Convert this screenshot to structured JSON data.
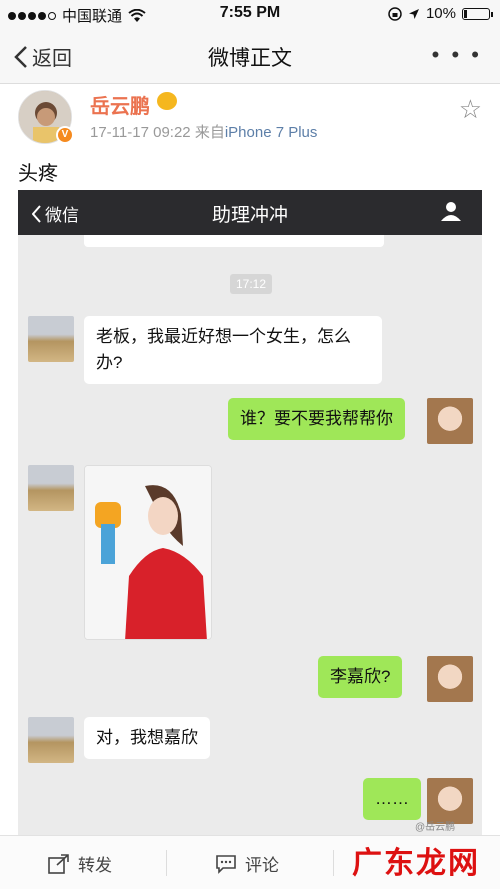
{
  "status": {
    "carrier": "中国联通",
    "time": "7:55 PM",
    "battery": "10%",
    "battery_level": 0.1
  },
  "nav": {
    "back_label": "返回",
    "title": "微博正文",
    "more_label": "• • •"
  },
  "post": {
    "author": "岳云鹏",
    "date": "17-11-17 09:22",
    "source_prefix": "来自",
    "source": "iPhone 7 Plus",
    "text": "头疼"
  },
  "chat": {
    "back_label": "微信",
    "title": "助理冲冲",
    "time_badge": "17:12",
    "messages": [
      {
        "side": "left",
        "text": "老板，我最近好想一个女生，怎么办?"
      },
      {
        "side": "right",
        "text": "谁？要不要我帮帮你"
      },
      {
        "side": "left",
        "type": "image"
      },
      {
        "side": "right",
        "text": "李嘉欣?"
      },
      {
        "side": "left",
        "text": "对，我想嘉欣"
      },
      {
        "side": "right",
        "text": "……"
      }
    ]
  },
  "actions": {
    "repost": "转发",
    "comment": "评论"
  },
  "watermark": {
    "text": "广东龙网",
    "small": "@岳云鹏"
  },
  "colors": {
    "accent": "#eb7350",
    "chat_green": "#9fe758",
    "wechat_header": "#2b2b2e"
  }
}
